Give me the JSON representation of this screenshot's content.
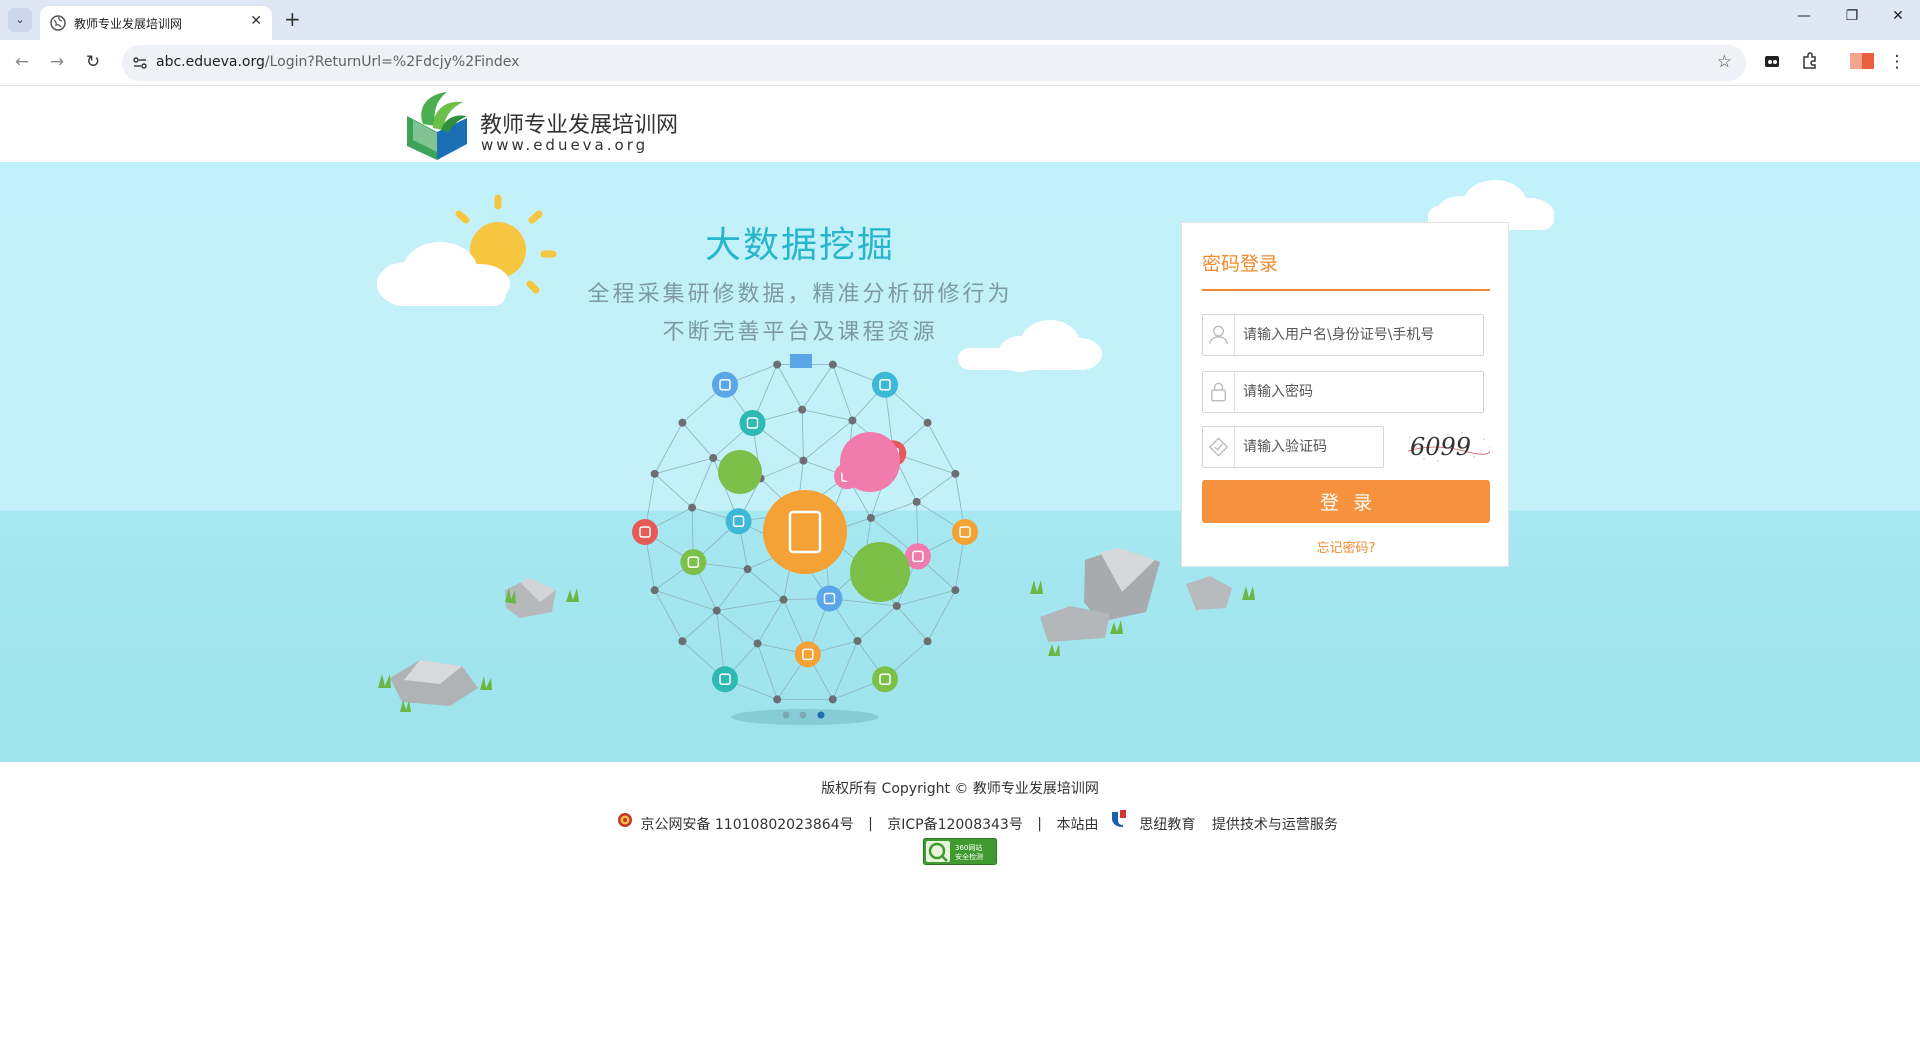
{
  "browser": {
    "tab_title": "教师专业发展培训网",
    "url_host": "abc.edueva.org",
    "url_path": "/Login?ReturnUrl=%2Fdcjy%2Findex"
  },
  "header": {
    "site_name": "教师专业发展培训网",
    "site_url": "www.edueva.org"
  },
  "banner": {
    "headline": "大数据挖掘",
    "subline1": "全程采集研修数据，精准分析研修行为",
    "subline2": "不断完善平台及课程资源",
    "slide_indicators": 3,
    "active_slide": 3
  },
  "login": {
    "title": "密码登录",
    "username_placeholder": "请输入用户名\\身份证号\\手机号",
    "password_placeholder": "请输入密码",
    "captcha_placeholder": "请输入验证码",
    "captcha_text": "6099",
    "submit_label": "登录",
    "forgot_label": "忘记密码?"
  },
  "footer": {
    "copyright": "版权所有 Copyright © 教师专业发展培训网",
    "police_record": "京公网安备 11010802023864号",
    "icp_record": "京ICP备12008343号",
    "provider_prefix": "本站由",
    "provider_name": "思纽教育",
    "provider_suffix": "提供技术与运营服务",
    "badge_text": "360网站安全检测"
  },
  "colors": {
    "accent": "#f6913e",
    "headline": "#27b5cc",
    "sky": "#c1f1fa",
    "water": "#9de2ec"
  }
}
